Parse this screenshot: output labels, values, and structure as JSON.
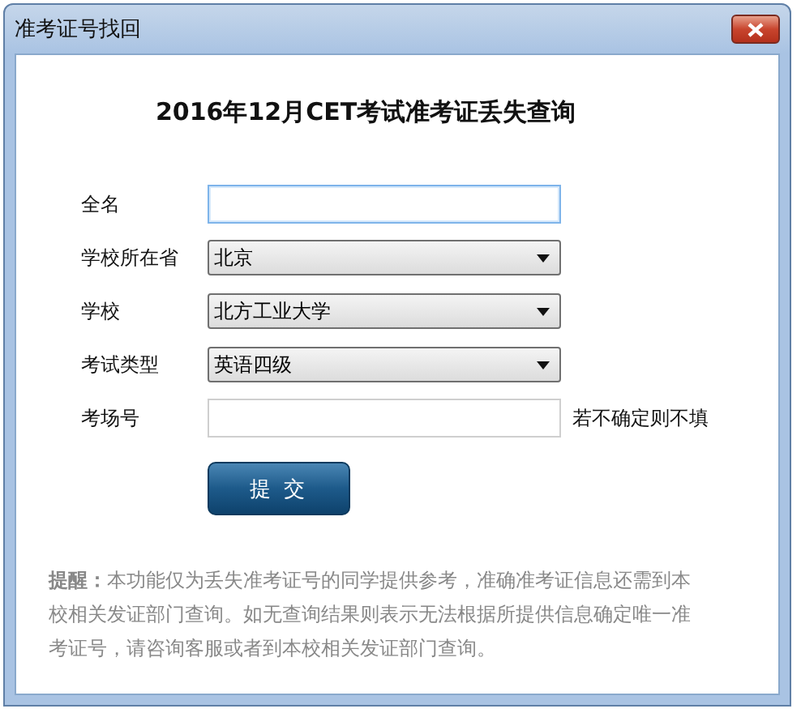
{
  "window": {
    "title": "准考证号找回"
  },
  "heading": "2016年12月CET考试准考证丢失查询",
  "fields": [
    {
      "label": "全名",
      "kind": "input",
      "focused": true
    },
    {
      "label": "学校所在省",
      "kind": "select",
      "value": "北京"
    },
    {
      "label": "学校",
      "kind": "select",
      "value": "北方工业大学"
    },
    {
      "label": "考试类型",
      "kind": "select",
      "value": "英语四级"
    },
    {
      "label": "考场号",
      "kind": "input",
      "focused": false,
      "hint": "若不确定则不填"
    }
  ],
  "submit_button": "提 交",
  "notice": "**提醒：**本功能仅为丢失准考证号的同学提供参考，准确准考证信息还需到本校相关发证部门查询。如无查询结果则表示无法根据所提供信息确定唯一准考证号，请咨询客服或者到本校相关发证部门查询。"
}
